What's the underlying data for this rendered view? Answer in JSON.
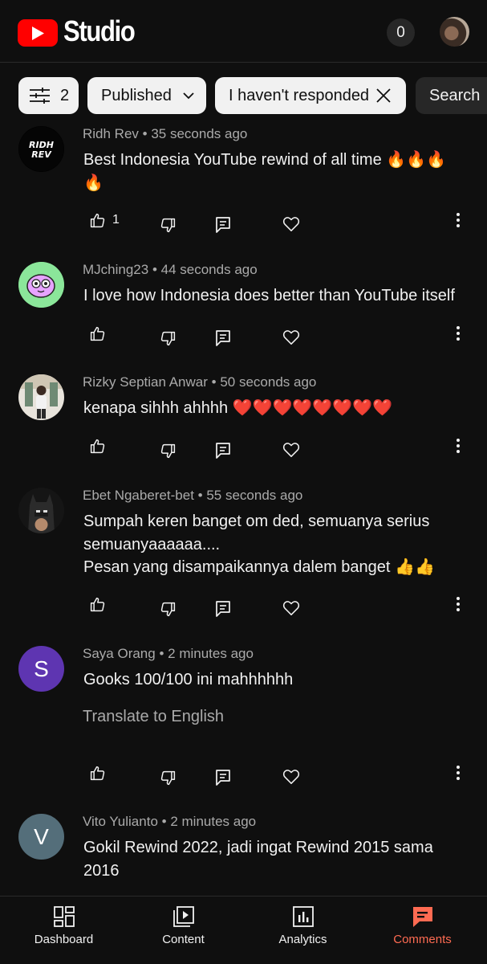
{
  "header": {
    "brand": "Studio",
    "notification_count": "0"
  },
  "filters": {
    "filter_count": "2",
    "published_label": "Published",
    "responded_label": "I haven't responded",
    "search_label": "Search"
  },
  "comments": [
    {
      "author": "Ridh Rev",
      "time": "35 seconds ago",
      "text_line1": "Best Indonesia YouTube rewind of all time 🔥🔥🔥",
      "text_line2": "🔥",
      "likes": "1",
      "avatar_text": "RIDH REV"
    },
    {
      "author": "MJching23",
      "time": "44 seconds ago",
      "text_line1": "I love how Indonesia does better than YouTube itself"
    },
    {
      "author": "Rizky Septian Anwar",
      "time": "50 seconds ago",
      "text_line1": "kenapa sihhh ahhhh ❤️❤️❤️❤️❤️❤️❤️❤️"
    },
    {
      "author": "Ebet Ngaberet-bet",
      "time": "55 seconds ago",
      "text_line1": "Sumpah keren banget om ded, semuanya serius",
      "text_line2": "semuanyaaaaaa....",
      "text_line3": "Pesan yang disampaikannya dalem banget 👍👍"
    },
    {
      "author": "Saya Orang",
      "time": "2 minutes ago",
      "text_line1": "Gooks 100/100 ini mahhhhhh",
      "translate": "Translate to English",
      "avatar_letter": "S",
      "avatar_color": "#5e35b1"
    },
    {
      "author": "Vito Yulianto",
      "time": "2 minutes ago",
      "text_line1": "Gokil Rewind 2022, jadi ingat Rewind 2015 sama",
      "text_line2": "2016",
      "avatar_letter": "V",
      "avatar_color": "#546e7a"
    }
  ],
  "meta_separator": "•",
  "nav": {
    "dashboard": "Dashboard",
    "content": "Content",
    "analytics": "Analytics",
    "comments": "Comments"
  },
  "colors": {
    "background": "#0f0f0f",
    "brand_red": "#ff0000",
    "active_tab": "#ff6b52",
    "secondary_text": "#aaaaaa"
  }
}
